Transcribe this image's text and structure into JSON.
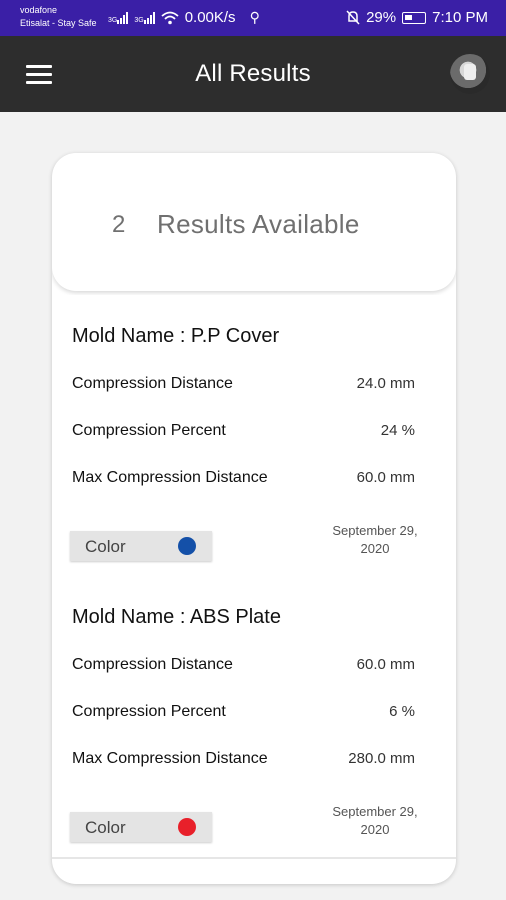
{
  "status_bar": {
    "carrier1": "vodafone",
    "carrier2": "Etisalat - Stay Safe",
    "net1": "3G",
    "net2": "3G",
    "speed": "0.00K/s",
    "usb_icon": "usb-icon",
    "battery": "29%",
    "time": "7:10 PM",
    "bg_color": "#3a1fa6"
  },
  "app_bar": {
    "title": "All Results",
    "bg_color": "#2d2d2d"
  },
  "summary": {
    "count": "2",
    "label": "Results Available"
  },
  "results": [
    {
      "mold_name": "Mold Name : P.P Cover",
      "rows": [
        {
          "label": "Compression Distance",
          "value": "24.0 mm"
        },
        {
          "label": "Compression Percent",
          "value": "24 %"
        },
        {
          "label": "Max Compression Distance",
          "value": "60.0 mm"
        }
      ],
      "color_label": "Color",
      "color": "#1450a8",
      "date_line1": "September 29,",
      "date_line2": "2020"
    },
    {
      "mold_name": "Mold Name : ABS Plate",
      "rows": [
        {
          "label": "Compression Distance",
          "value": "60.0 mm"
        },
        {
          "label": "Compression Percent",
          "value": "6 %"
        },
        {
          "label": "Max Compression Distance",
          "value": "280.0 mm"
        }
      ],
      "color_label": "Color",
      "color": "#e8202a",
      "date_line1": "September 29,",
      "date_line2": "2020"
    }
  ]
}
